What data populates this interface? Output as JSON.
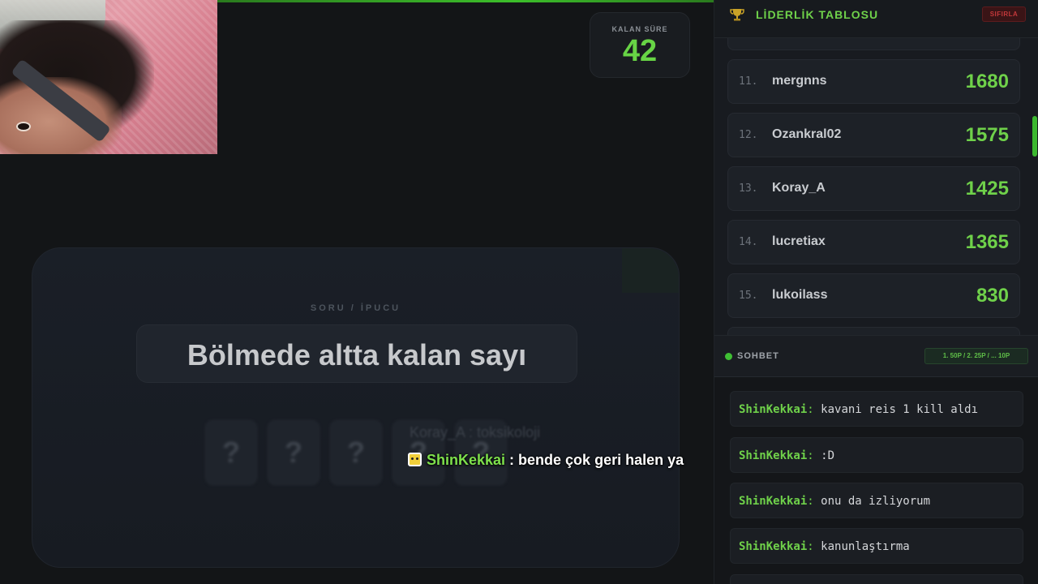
{
  "timer": {
    "label": "KALAN SÜRE",
    "value": "42"
  },
  "question": {
    "label": "SORU / İPUCU",
    "text": "Bölmede altta kalan sayı",
    "tiles": [
      "?",
      "?",
      "?",
      "?",
      "?"
    ],
    "ghost_message": "Koray_A : toksikoloji"
  },
  "overlay_chat": {
    "user": "ShinKekkai",
    "text": " : bende çok geri halen ya"
  },
  "leaderboard": {
    "title": "LİDERLİK TABLOSU",
    "reset_label": "SIFIRLA",
    "rows": [
      {
        "rank": "11.",
        "name": "mergnns",
        "score": "1680"
      },
      {
        "rank": "12.",
        "name": "Ozankral02",
        "score": "1575"
      },
      {
        "rank": "13.",
        "name": "Koray_A",
        "score": "1425"
      },
      {
        "rank": "14.",
        "name": "lucretiax",
        "score": "1365"
      },
      {
        "rank": "15.",
        "name": "lukoilass",
        "score": "830"
      }
    ]
  },
  "chat": {
    "title": "SOHBET",
    "points_badge": "1. 50P / 2. 25P / ... 10P",
    "messages": [
      {
        "user": "ShinKekkai",
        "text": "kavani reis 1 kill aldı"
      },
      {
        "user": "ShinKekkai",
        "text": ":D"
      },
      {
        "user": "ShinKekkai",
        "text": "onu da izliyorum"
      },
      {
        "user": "ShinKekkai",
        "text": "kanunlaştırma"
      }
    ]
  },
  "colors": {
    "accent": "#6fd14a",
    "background": "#131517",
    "danger": "#c3383a"
  }
}
